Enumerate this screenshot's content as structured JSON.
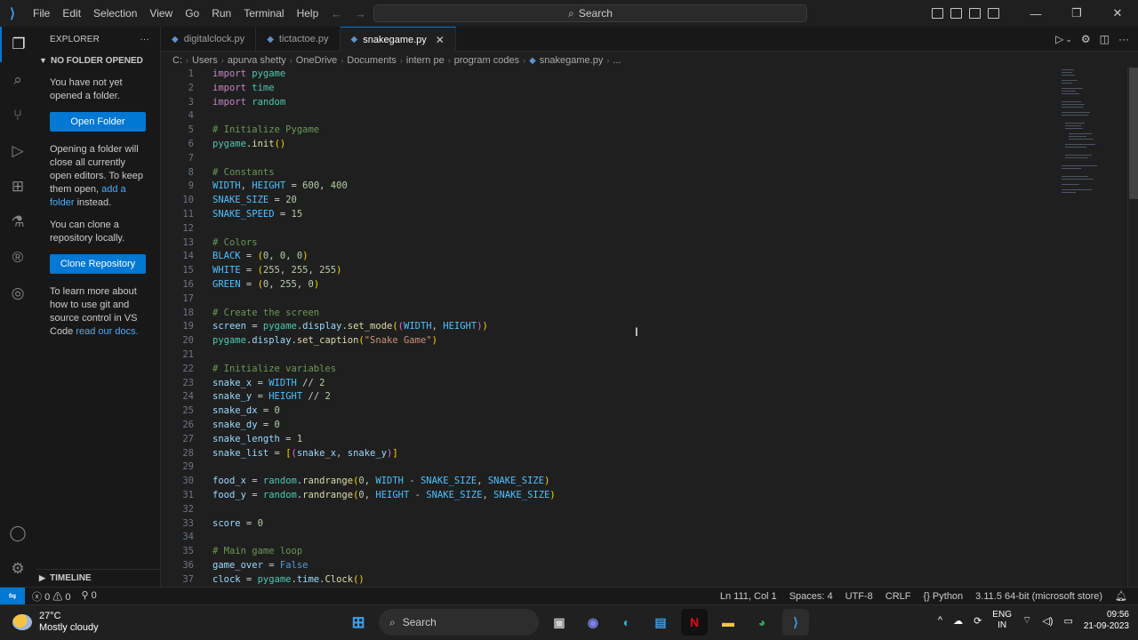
{
  "titlebar": {
    "menu": [
      "File",
      "Edit",
      "Selection",
      "View",
      "Go",
      "Run",
      "Terminal",
      "Help"
    ],
    "search": "Search"
  },
  "sidebar": {
    "title": "EXPLORER",
    "section": "NO FOLDER OPENED",
    "p1": "You have not yet opened a folder.",
    "open_btn": "Open Folder",
    "p2_a": "Opening a folder will close all currently open editors. To keep them open,",
    "p2_link": "add a folder",
    "p2_b": "instead.",
    "p3": "You can clone a repository locally.",
    "clone_btn": "Clone Repository",
    "p4_a": "To learn more about how to use git and source control in VS Code",
    "p4_link": "read our docs.",
    "timeline": "TIMELINE"
  },
  "tabs": [
    {
      "label": "digitalclock.py"
    },
    {
      "label": "tictactoe.py"
    },
    {
      "label": "snakegame.py"
    }
  ],
  "breadcrumbs": [
    "C:",
    "Users",
    "apurva shetty",
    "OneDrive",
    "Documents",
    "intern pe",
    "program codes",
    "snakegame.py",
    "..."
  ],
  "code": {
    "l1": "1",
    "l2": "2",
    "l3": "3",
    "l4": "4",
    "l5": "5",
    "l6": "6",
    "l7": "7",
    "l8": "8",
    "l9": "9",
    "l10": "10",
    "l11": "11",
    "l12": "12",
    "l13": "13",
    "l14": "14",
    "l15": "15",
    "l16": "16",
    "l17": "17",
    "l18": "18",
    "l19": "19",
    "l20": "20",
    "l21": "21",
    "l22": "22",
    "l23": "23",
    "l24": "24",
    "l25": "25",
    "l26": "26",
    "l27": "27",
    "l28": "28",
    "l29": "29",
    "l30": "30",
    "l31": "31",
    "l32": "32",
    "l33": "33",
    "l34": "34",
    "l35": "35",
    "l36": "36",
    "l37": "37"
  },
  "statusbar": {
    "errors": "0",
    "warnings": "0",
    "ports": "0",
    "position": "Ln 111, Col 1",
    "spaces": "Spaces: 4",
    "encoding": "UTF-8",
    "eol": "CRLF",
    "language": "Python",
    "interpreter": "3.11.5 64-bit (microsoft store)"
  },
  "taskbar": {
    "temp": "27°C",
    "weather": "Mostly cloudy",
    "search": "Search",
    "lang1": "ENG",
    "lang2": "IN",
    "time": "09:56",
    "date": "21-09-2023"
  }
}
